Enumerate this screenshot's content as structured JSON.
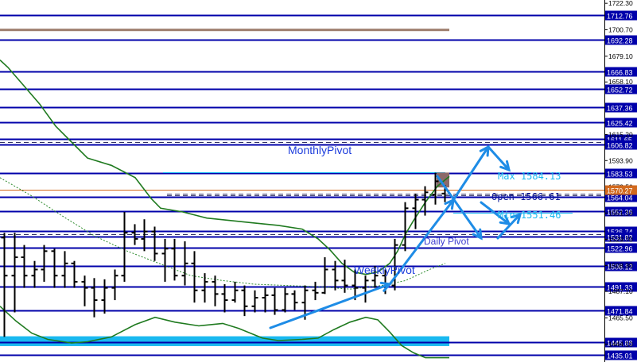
{
  "chart_data": {
    "type": "candlestick",
    "title": "",
    "price_axis": {
      "ylim": [
        1429.5,
        1725.0
      ],
      "tick_labels": [
        "1722.30",
        "1700.70",
        "1679.10",
        "1658.10",
        "1615.20",
        "1593.90",
        "1572.50",
        "1551.10",
        "1529.70",
        "1508.30",
        "1487.10",
        "1465.50",
        "1444.10"
      ]
    },
    "level_lines": [
      {
        "price": 1712.76,
        "label": "1712.76",
        "color": "#0000aa"
      },
      {
        "price": 1692.28,
        "label": "1692.28",
        "color": "#0000aa"
      },
      {
        "price": 1666.83,
        "label": "1666.83",
        "color": "#0000aa"
      },
      {
        "price": 1652.72,
        "label": "1652.72",
        "color": "#0000aa"
      },
      {
        "price": 1637.36,
        "label": "1637.36",
        "color": "#0000aa"
      },
      {
        "price": 1625.42,
        "label": "1625.42",
        "color": "#0000aa"
      },
      {
        "price": 1611.65,
        "label": "1611.65",
        "color": "#0000aa"
      },
      {
        "price": 1606.82,
        "label": "1606.82",
        "color": "#0000aa"
      },
      {
        "price": 1583.53,
        "label": "1583.53",
        "color": "#0000aa"
      },
      {
        "price": 1564.04,
        "label": "1564.04",
        "color": "#0000aa"
      },
      {
        "price": 1552.36,
        "label": "1552.36",
        "color": "#0000aa"
      },
      {
        "price": 1536.74,
        "label": "1536.74",
        "color": "#0000aa"
      },
      {
        "price": 1531.82,
        "label": "1531.82",
        "color": "#0000aa"
      },
      {
        "price": 1522.96,
        "label": "1522.96",
        "color": "#0000aa"
      },
      {
        "price": 1508.12,
        "label": "1508.12",
        "color": "#0000aa"
      },
      {
        "price": 1491.33,
        "label": "1491.33",
        "color": "#0000aa"
      },
      {
        "price": 1471.84,
        "label": "1471.84",
        "color": "#0000aa"
      },
      {
        "price": 1445.88,
        "label": "1445.88",
        "color": "#0000aa"
      },
      {
        "price": 1435.01,
        "label": "1435.01",
        "color": "#0000aa"
      }
    ],
    "current_price": {
      "price": 1570.2,
      "label": "1570.27",
      "color": "#d2691e"
    },
    "zones": [
      {
        "price_high": 1701.6,
        "price_low": 1699.6,
        "color": "#a08070"
      },
      {
        "price_high": 1450.5,
        "price_low": 1442.5,
        "color": "#19b9f0"
      }
    ],
    "annotations": {
      "monthly_pivot": "MonthlyPivot",
      "weekly_pivot": "WeeklyPivot",
      "daily_pivot": "Daily Pivot",
      "max": "Max 1584.13",
      "open": "Open 1566.61",
      "min": "Min 1551.46"
    },
    "bars": [
      {
        "o": 1531,
        "h": 1535,
        "l": 1450,
        "c": 1500
      },
      {
        "o": 1500,
        "h": 1535,
        "l": 1470,
        "c": 1515
      },
      {
        "o": 1515,
        "h": 1525,
        "l": 1490,
        "c": 1500
      },
      {
        "o": 1500,
        "h": 1512,
        "l": 1490,
        "c": 1505
      },
      {
        "o": 1505,
        "h": 1525,
        "l": 1495,
        "c": 1520
      },
      {
        "o": 1520,
        "h": 1522,
        "l": 1490,
        "c": 1500
      },
      {
        "o": 1500,
        "h": 1520,
        "l": 1490,
        "c": 1510
      },
      {
        "o": 1510,
        "h": 1512,
        "l": 1490,
        "c": 1495
      },
      {
        "o": 1495,
        "h": 1500,
        "l": 1475,
        "c": 1490
      },
      {
        "o": 1490,
        "h": 1498,
        "l": 1466,
        "c": 1480
      },
      {
        "o": 1480,
        "h": 1497,
        "l": 1469,
        "c": 1490
      },
      {
        "o": 1490,
        "h": 1505,
        "l": 1480,
        "c": 1500
      },
      {
        "o": 1500,
        "h": 1552,
        "l": 1495,
        "c": 1535
      },
      {
        "o": 1535,
        "h": 1542,
        "l": 1525,
        "c": 1530
      },
      {
        "o": 1530,
        "h": 1546,
        "l": 1520,
        "c": 1536
      },
      {
        "o": 1536,
        "h": 1540,
        "l": 1512,
        "c": 1518
      },
      {
        "o": 1518,
        "h": 1530,
        "l": 1495,
        "c": 1522
      },
      {
        "o": 1522,
        "h": 1530,
        "l": 1496,
        "c": 1500
      },
      {
        "o": 1500,
        "h": 1528,
        "l": 1492,
        "c": 1510
      },
      {
        "o": 1510,
        "h": 1520,
        "l": 1478,
        "c": 1488
      },
      {
        "o": 1488,
        "h": 1502,
        "l": 1478,
        "c": 1495
      },
      {
        "o": 1495,
        "h": 1500,
        "l": 1475,
        "c": 1485
      },
      {
        "o": 1485,
        "h": 1493,
        "l": 1470,
        "c": 1480
      },
      {
        "o": 1480,
        "h": 1495,
        "l": 1478,
        "c": 1488
      },
      {
        "o": 1488,
        "h": 1492,
        "l": 1467,
        "c": 1475
      },
      {
        "o": 1475,
        "h": 1488,
        "l": 1470,
        "c": 1482
      },
      {
        "o": 1482,
        "h": 1490,
        "l": 1470,
        "c": 1484
      },
      {
        "o": 1484,
        "h": 1490,
        "l": 1468,
        "c": 1472
      },
      {
        "o": 1472,
        "h": 1490,
        "l": 1470,
        "c": 1485
      },
      {
        "o": 1485,
        "h": 1488,
        "l": 1472,
        "c": 1478
      },
      {
        "o": 1478,
        "h": 1492,
        "l": 1464,
        "c": 1488
      },
      {
        "o": 1488,
        "h": 1495,
        "l": 1480,
        "c": 1486
      },
      {
        "o": 1486,
        "h": 1515,
        "l": 1485,
        "c": 1505
      },
      {
        "o": 1505,
        "h": 1512,
        "l": 1488,
        "c": 1496
      },
      {
        "o": 1496,
        "h": 1513,
        "l": 1486,
        "c": 1492
      },
      {
        "o": 1492,
        "h": 1505,
        "l": 1480,
        "c": 1490
      },
      {
        "o": 1490,
        "h": 1500,
        "l": 1478,
        "c": 1496
      },
      {
        "o": 1496,
        "h": 1508,
        "l": 1490,
        "c": 1500
      },
      {
        "o": 1500,
        "h": 1505,
        "l": 1485,
        "c": 1492
      },
      {
        "o": 1492,
        "h": 1530,
        "l": 1488,
        "c": 1525
      },
      {
        "o": 1525,
        "h": 1560,
        "l": 1520,
        "c": 1555
      },
      {
        "o": 1555,
        "h": 1567,
        "l": 1538,
        "c": 1562
      },
      {
        "o": 1562,
        "h": 1573,
        "l": 1549,
        "c": 1568
      },
      {
        "o": 1566,
        "h": 1584,
        "l": 1558,
        "c": 1577
      },
      {
        "o": 1567,
        "h": 1574,
        "l": 1560,
        "c": 1570
      }
    ],
    "ma_green": [
      [
        0,
        1676
      ],
      [
        10,
        1670
      ],
      [
        30,
        1655
      ],
      [
        50,
        1640
      ],
      [
        70,
        1622
      ],
      [
        90,
        1609
      ],
      [
        110,
        1596
      ],
      [
        140,
        1590
      ],
      [
        170,
        1580
      ],
      [
        190,
        1563
      ],
      [
        202,
        1555
      ],
      [
        230,
        1552
      ],
      [
        260,
        1547
      ],
      [
        290,
        1545
      ],
      [
        320,
        1543
      ],
      [
        350,
        1541
      ],
      [
        380,
        1538
      ],
      [
        400,
        1530
      ],
      [
        415,
        1521
      ],
      [
        430,
        1510
      ],
      [
        445,
        1503
      ],
      [
        460,
        1501
      ],
      [
        475,
        1503
      ],
      [
        490,
        1510
      ],
      [
        500,
        1520
      ],
      [
        510,
        1534
      ],
      [
        520,
        1545
      ],
      [
        535,
        1560
      ],
      [
        550,
        1573
      ],
      [
        565,
        1581
      ]
    ],
    "ma_dotted": [
      [
        0,
        1580
      ],
      [
        40,
        1565
      ],
      [
        80,
        1548
      ],
      [
        120,
        1532
      ],
      [
        160,
        1520
      ],
      [
        200,
        1510
      ],
      [
        240,
        1500
      ],
      [
        280,
        1496
      ],
      [
        320,
        1493
      ],
      [
        360,
        1492
      ],
      [
        400,
        1491
      ],
      [
        440,
        1489
      ],
      [
        480,
        1492
      ],
      [
        510,
        1496
      ],
      [
        540,
        1505
      ],
      [
        560,
        1510
      ]
    ],
    "osc_green": [
      [
        0,
        1475
      ],
      [
        20,
        1463
      ],
      [
        40,
        1453
      ],
      [
        60,
        1448
      ],
      [
        90,
        1445
      ],
      [
        110,
        1446
      ],
      [
        140,
        1450
      ],
      [
        170,
        1460
      ],
      [
        195,
        1466
      ],
      [
        220,
        1462
      ],
      [
        250,
        1459
      ],
      [
        280,
        1461
      ],
      [
        300,
        1457
      ],
      [
        330,
        1449
      ],
      [
        350,
        1447
      ],
      [
        380,
        1448
      ],
      [
        400,
        1449
      ],
      [
        420,
        1456
      ],
      [
        440,
        1462
      ],
      [
        460,
        1466
      ],
      [
        475,
        1464
      ],
      [
        490,
        1454
      ],
      [
        505,
        1443
      ],
      [
        520,
        1437
      ],
      [
        535,
        1433
      ],
      [
        565,
        1433
      ]
    ]
  }
}
